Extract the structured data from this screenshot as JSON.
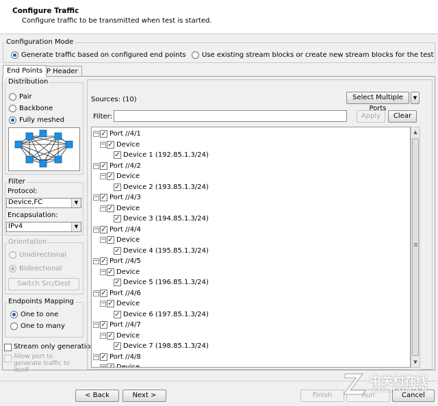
{
  "header": {
    "title": "Configure Traffic",
    "subtitle": "Configure traffic to be transmitted when test is started."
  },
  "config_mode": {
    "label": "Configuration Mode",
    "option1": "Generate traffic based on configured end points",
    "option2": "Use existing stream blocks or create new stream blocks for the test",
    "selected": "option1"
  },
  "tabs": [
    "End Points",
    "IP Header"
  ],
  "distribution": {
    "label": "Distribution",
    "options": [
      "Pair",
      "Backbone",
      "Fully meshed"
    ],
    "selected": "Fully meshed"
  },
  "filter": {
    "label": "Filter",
    "protocol_label": "Protocol:",
    "protocol_value": "Device,FC",
    "encapsulation_label": "Encapsulation:",
    "encapsulation_value": "IPv4"
  },
  "orientation": {
    "label": "Orientation",
    "options": [
      "Unidirectional",
      "Bidirectional"
    ],
    "selected": "Bidirectional",
    "switch_button": "Switch Src/Dest"
  },
  "endpoints_mapping": {
    "label": "Endpoints Mapping",
    "options": [
      "One to one",
      "One to many"
    ],
    "selected": "One to one"
  },
  "stream_only": "Stream only generation",
  "allow_port": "Allow port to generate traffic to itself",
  "sources": {
    "label": "Sources: (10)",
    "select_multiple": "Select Multiple Ports",
    "filter_label": "Filter:",
    "filter_value": "",
    "apply": "Apply",
    "clear": "Clear"
  },
  "tree": [
    {
      "port": "Port //4/1",
      "device_group": "Device",
      "device": "Device 1 (192.85.1.3/24)"
    },
    {
      "port": "Port //4/2",
      "device_group": "Device",
      "device": "Device 2 (193.85.1.3/24)"
    },
    {
      "port": "Port //4/3",
      "device_group": "Device",
      "device": "Device 3 (194.85.1.3/24)"
    },
    {
      "port": "Port //4/4",
      "device_group": "Device",
      "device": "Device 4 (195.85.1.3/24)"
    },
    {
      "port": "Port //4/5",
      "device_group": "Device",
      "device": "Device 5 (196.85.1.3/24)"
    },
    {
      "port": "Port //4/6",
      "device_group": "Device",
      "device": "Device 6 (197.85.1.3/24)"
    },
    {
      "port": "Port //4/7",
      "device_group": "Device",
      "device": "Device 7 (198.85.1.3/24)"
    },
    {
      "port": "Port //4/8",
      "device_group": "Device",
      "device": ""
    }
  ],
  "footer": {
    "back": "< Back",
    "next": "Next >",
    "finish": "Finish",
    "run": "Run",
    "cancel": "Cancel"
  },
  "watermark": {
    "cn": "中关村在线",
    "en": "ZOL.COM.CN"
  }
}
